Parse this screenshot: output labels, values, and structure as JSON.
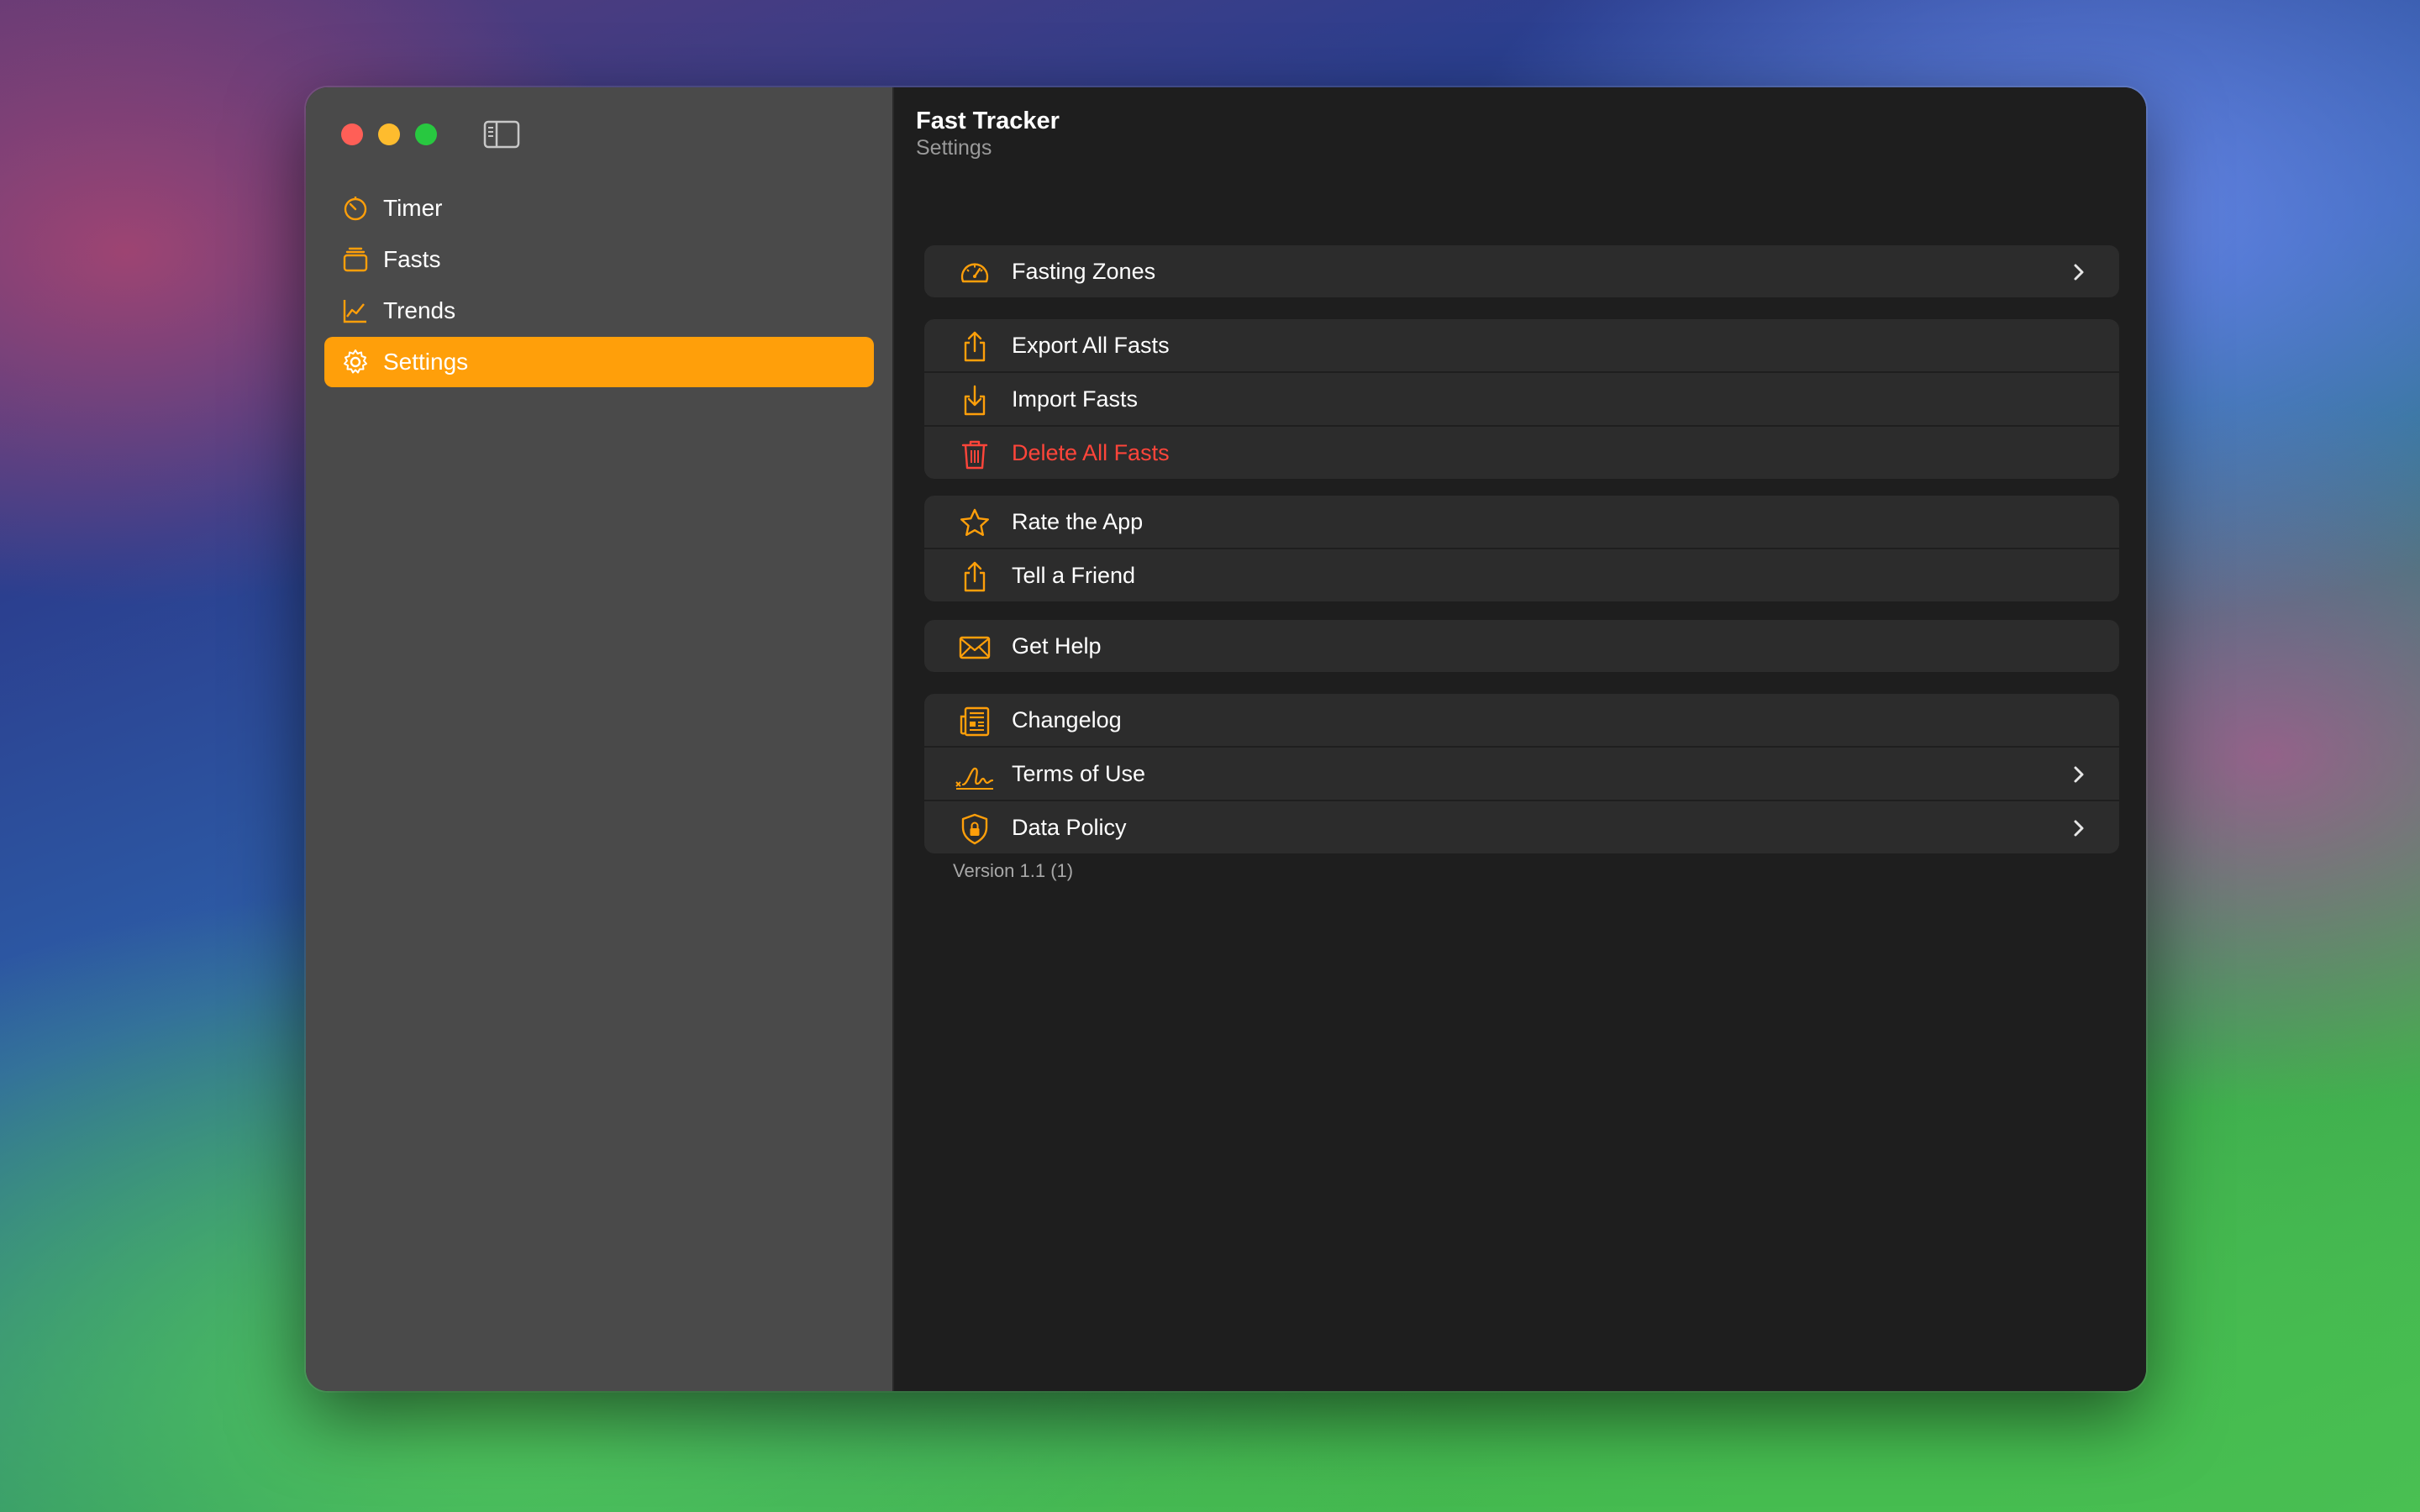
{
  "app": {
    "title": "Fast Tracker",
    "subtitle": "Settings",
    "accent_color": "#ff9f0a",
    "danger_color": "#ff453a"
  },
  "sidebar": {
    "items": [
      {
        "label": "Timer",
        "icon": "timer-icon"
      },
      {
        "label": "Fasts",
        "icon": "stack-icon"
      },
      {
        "label": "Trends",
        "icon": "chart-line-icon"
      },
      {
        "label": "Settings",
        "icon": "gear-icon",
        "active": true
      }
    ]
  },
  "settings": {
    "fasting_zones": "Fasting Zones",
    "export_all": "Export All Fasts",
    "import": "Import Fasts",
    "delete_all": "Delete All Fasts",
    "rate_app": "Rate the App",
    "tell_friend": "Tell a Friend",
    "get_help": "Get Help",
    "changelog": "Changelog",
    "terms": "Terms of Use",
    "data_policy": "Data Policy",
    "version": "Version 1.1 (1)"
  }
}
